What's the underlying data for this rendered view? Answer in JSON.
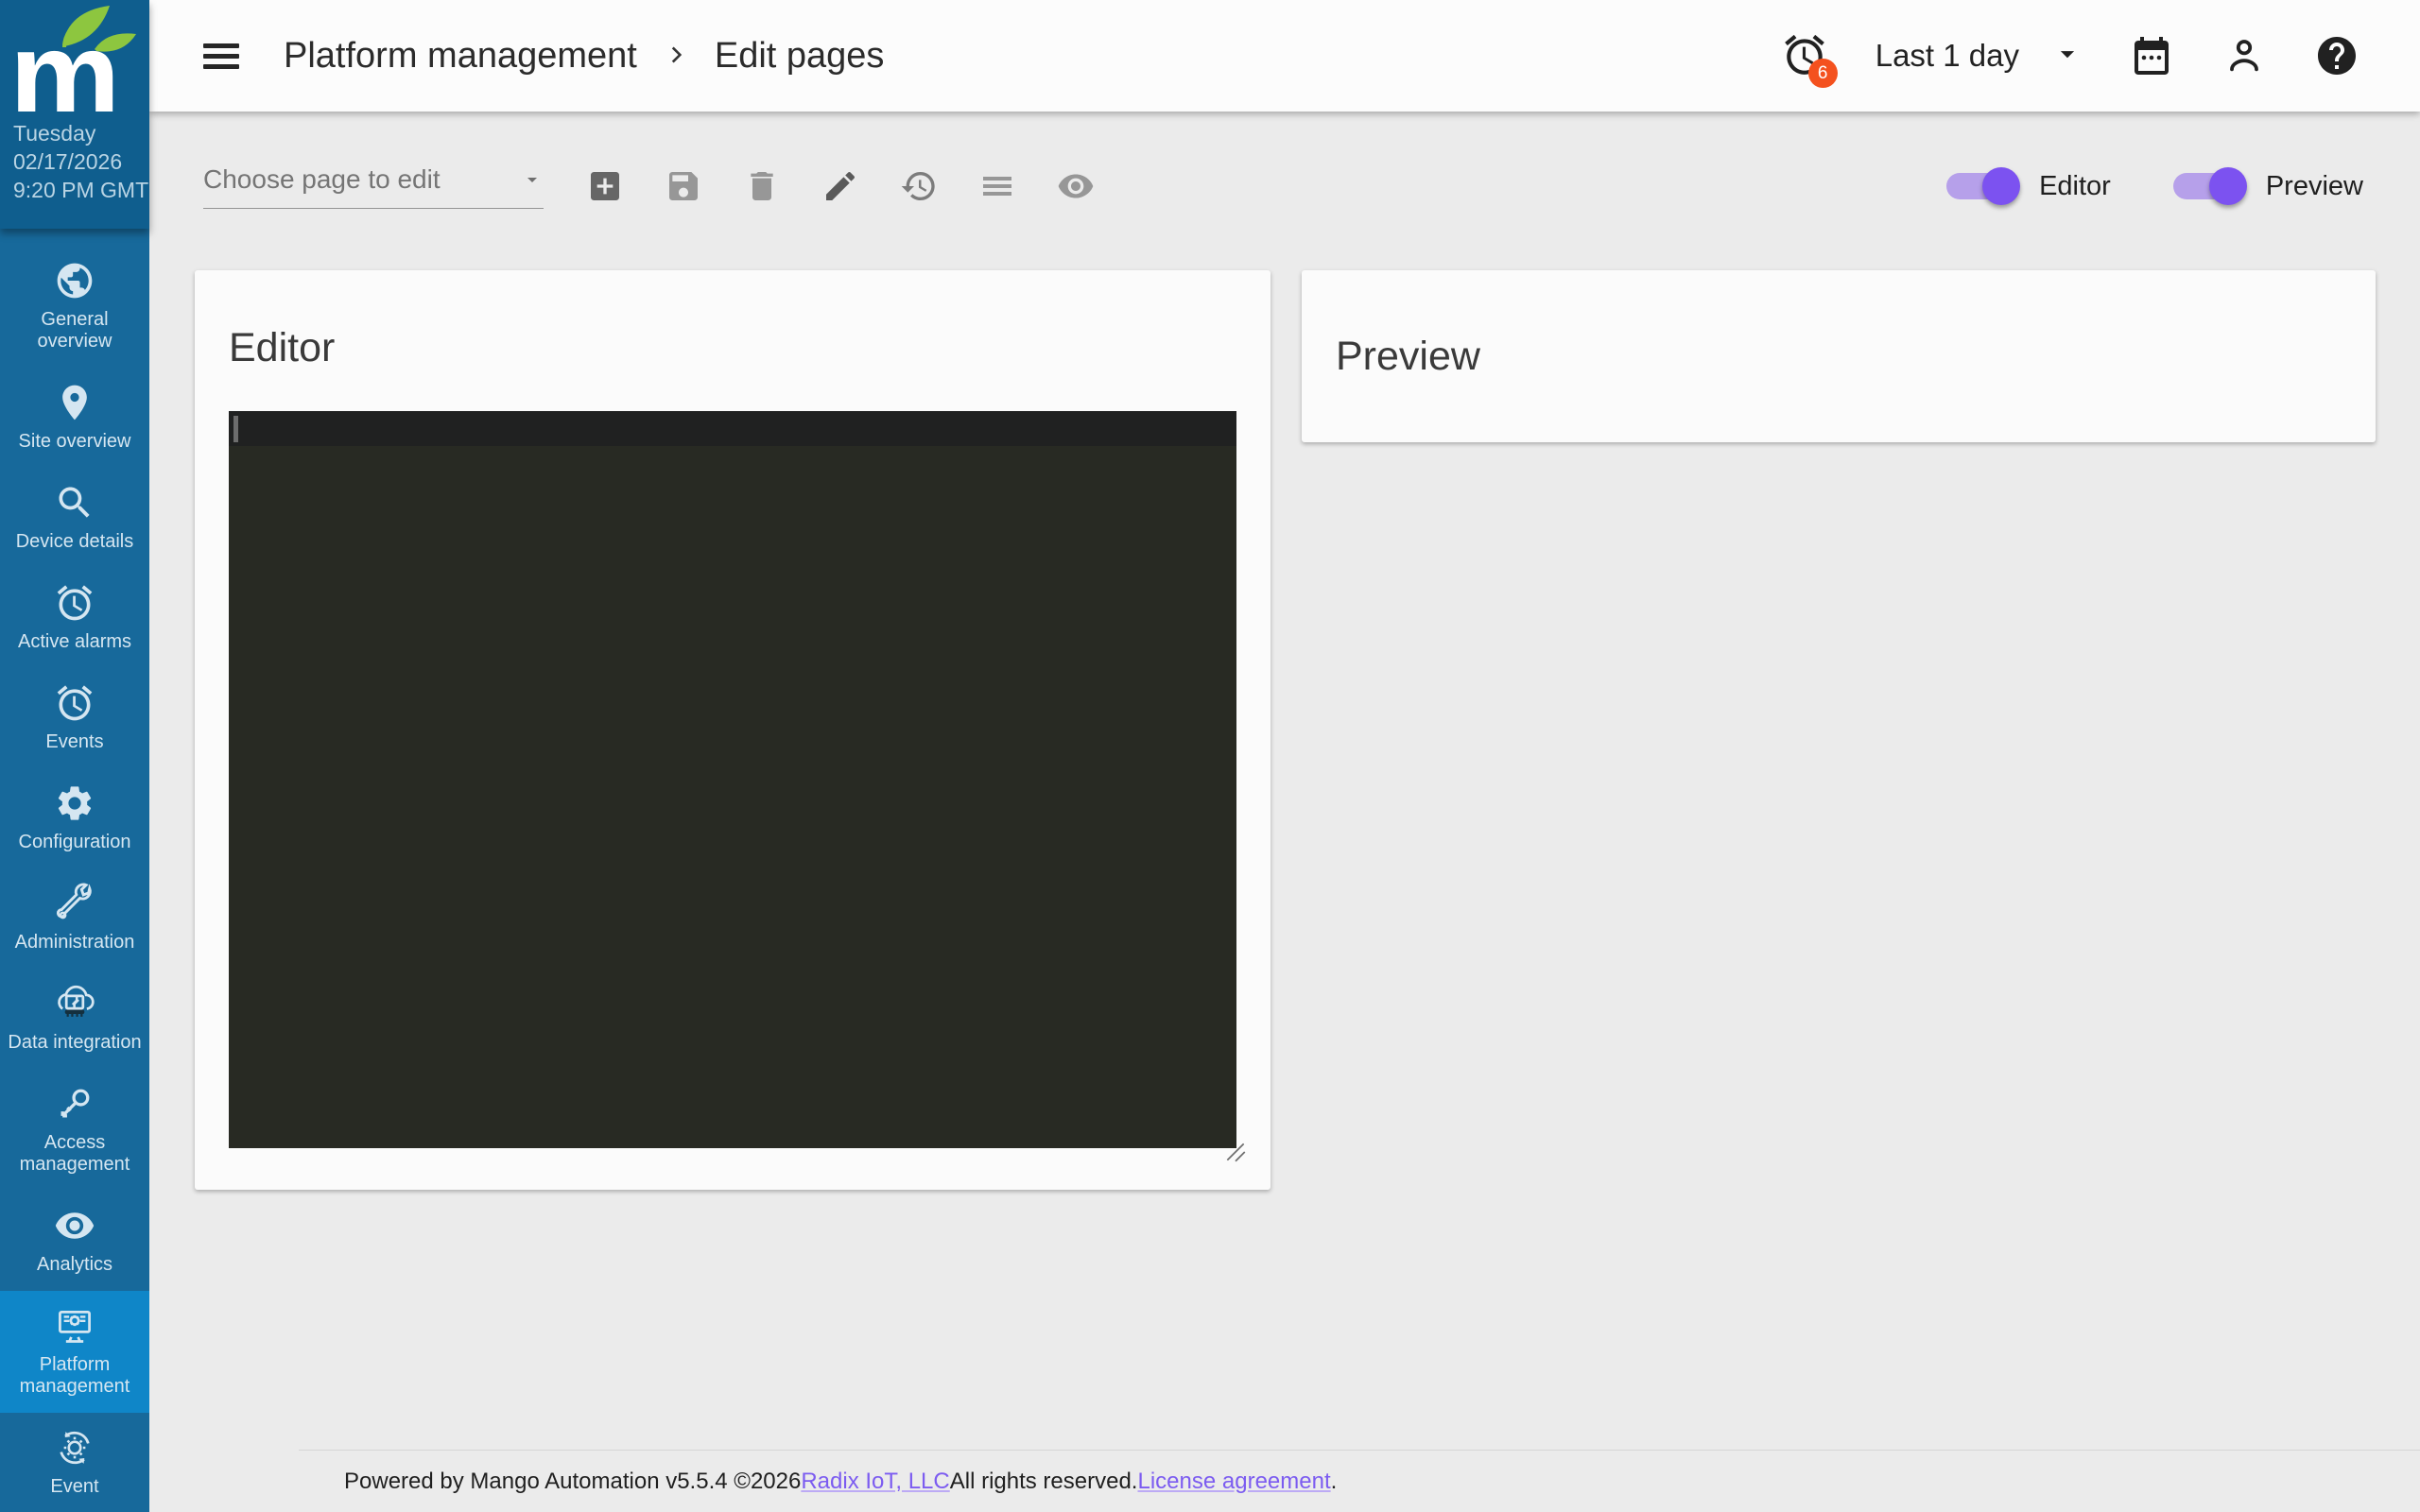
{
  "app": {
    "name": "Mango"
  },
  "sidebar": {
    "date": {
      "weekday": "Tuesday",
      "date": "02/17/2026",
      "time": "9:20 PM GMT"
    },
    "items": [
      {
        "label": "General overview",
        "icon": "globe-icon"
      },
      {
        "label": "Site overview",
        "icon": "map-pin-icon"
      },
      {
        "label": "Device details",
        "icon": "search-icon"
      },
      {
        "label": "Active alarms",
        "icon": "alarm-clock-icon"
      },
      {
        "label": "Events",
        "icon": "alarm-clock-icon"
      },
      {
        "label": "Configuration",
        "icon": "gear-icon"
      },
      {
        "label": "Administration",
        "icon": "wrench-icon"
      },
      {
        "label": "Data integration",
        "icon": "cloud-sync-icon"
      },
      {
        "label": "Access management",
        "icon": "key-icon"
      },
      {
        "label": "Analytics",
        "icon": "eye-icon"
      },
      {
        "label": "Platform management",
        "icon": "monitor-gear-icon",
        "active": true
      },
      {
        "label": "Event",
        "icon": "gear-sync-icon"
      }
    ]
  },
  "header": {
    "breadcrumb": [
      "Platform management",
      "Edit pages"
    ],
    "alarm_badge_count": "6",
    "time_range": "Last 1 day"
  },
  "toolbar": {
    "page_select_placeholder": "Choose page to edit",
    "buttons": [
      "add",
      "save",
      "delete",
      "edit",
      "history",
      "menu",
      "preview-visibility"
    ],
    "toggles": [
      {
        "label": "Editor",
        "on": true
      },
      {
        "label": "Preview",
        "on": true
      }
    ]
  },
  "panels": {
    "editor_title": "Editor",
    "preview_title": "Preview"
  },
  "footer": {
    "text_before": "Powered by Mango Automation v5.5.4 ©2026 ",
    "link_company": "Radix IoT, LLC",
    "text_mid": " All rights reserved. ",
    "link_license": "License agreement",
    "text_after": "."
  },
  "colors": {
    "sidebar_bg": "#17699b",
    "sidebar_brand_bg": "#0f5e8e",
    "sidebar_active_bg": "#0f86c8",
    "accent_purple": "#7c52f0",
    "badge_orange": "#f4511e",
    "leaf_green": "#8dc63f",
    "code_editor_bg": "#282a23",
    "content_bg": "#ebebeb"
  }
}
